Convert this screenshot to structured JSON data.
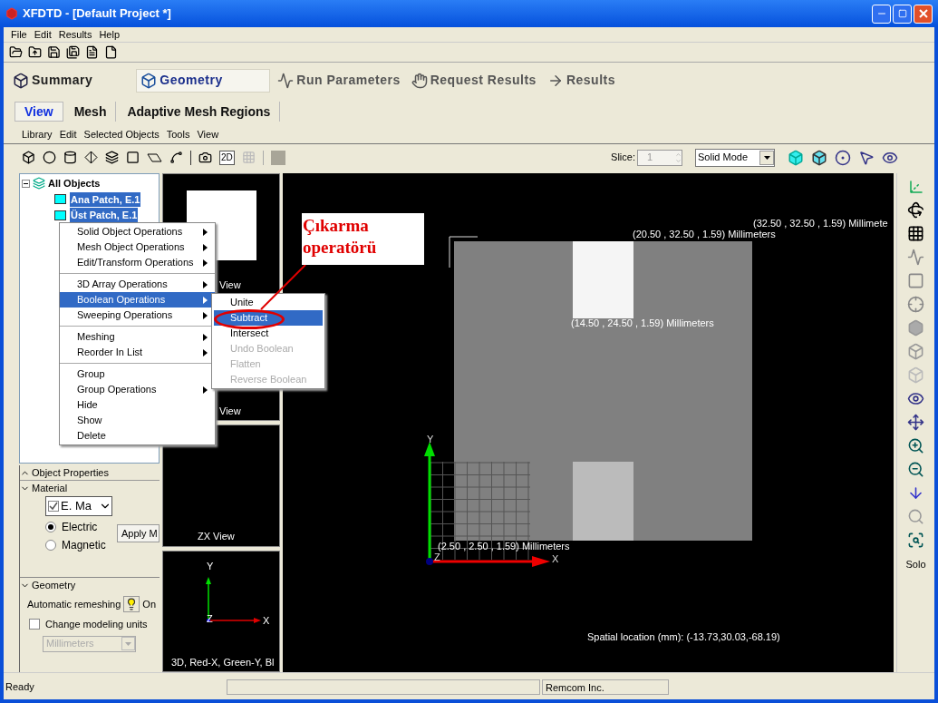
{
  "window": {
    "title": "XFDTD - [Default Project *]"
  },
  "menu": [
    "File",
    "Edit",
    "Results",
    "Help"
  ],
  "main_tabs": [
    {
      "label": "Summary",
      "selected": false
    },
    {
      "label": "Geometry",
      "selected": true
    },
    {
      "label": "Run Parameters",
      "selected": false
    },
    {
      "label": "Request Results",
      "selected": false
    },
    {
      "label": "Results",
      "selected": false
    }
  ],
  "sub_tabs": [
    {
      "label": "View",
      "selected": true
    },
    {
      "label": "Mesh",
      "selected": false
    },
    {
      "label": "Adaptive Mesh Regions",
      "selected": false
    }
  ],
  "geometry_menu": [
    "Library",
    "Edit",
    "Selected Objects",
    "Tools",
    "View"
  ],
  "tool_text_button": "2D",
  "slice": {
    "label": "Slice:",
    "value": "1"
  },
  "mode": {
    "value": "Solid Mode"
  },
  "tree": {
    "label": "All Objects",
    "expanded": true,
    "children": [
      {
        "label": "Ana Patch, E.1",
        "selected": true
      },
      {
        "label": "Üst Patch, E.1",
        "selected": true
      }
    ]
  },
  "context_menu": {
    "groups": [
      [
        {
          "label": "Solid Object Operations",
          "submenu": true,
          "selected": false
        },
        {
          "label": "Mesh Object Operations",
          "submenu": true,
          "selected": false
        },
        {
          "label": "Edit/Transform Operations",
          "submenu": true,
          "selected": false
        }
      ],
      [
        {
          "label": "3D Array Operations",
          "submenu": true,
          "selected": false
        },
        {
          "label": "Boolean Operations",
          "submenu": true,
          "selected": true
        },
        {
          "label": "Sweeping Operations",
          "submenu": true,
          "selected": false
        }
      ],
      [
        {
          "label": "Meshing",
          "submenu": true,
          "selected": false
        },
        {
          "label": "Reorder In List",
          "submenu": true,
          "selected": false
        }
      ],
      [
        {
          "label": "Group",
          "submenu": false,
          "selected": false
        },
        {
          "label": "Group Operations",
          "submenu": true,
          "selected": false
        },
        {
          "label": "Hide",
          "submenu": false,
          "selected": false
        },
        {
          "label": "Show",
          "submenu": false,
          "selected": false
        },
        {
          "label": "Delete",
          "submenu": false,
          "selected": false
        }
      ]
    ]
  },
  "submenu": {
    "items": [
      {
        "label": "Unite",
        "selected": false,
        "disabled": false
      },
      {
        "label": "Subtract",
        "selected": true,
        "disabled": false
      },
      {
        "label": "Intersect",
        "selected": false,
        "disabled": false
      },
      {
        "label": "Undo Boolean",
        "selected": false,
        "disabled": true
      },
      {
        "label": "Flatten",
        "selected": false,
        "disabled": true
      },
      {
        "label": "Reverse Boolean",
        "selected": false,
        "disabled": true
      }
    ]
  },
  "callout": {
    "lines": [
      "Çıkarma",
      "operatörü"
    ]
  },
  "small_views": [
    {
      "label": "View",
      "kind": "rect"
    },
    {
      "label": "View",
      "kind": "empty"
    },
    {
      "label": "ZX View",
      "kind": "empty"
    },
    {
      "label": "3D, Red-X, Green-Y, Bl",
      "kind": "axes",
      "axes": [
        "X",
        "Y",
        "Z"
      ]
    }
  ],
  "viewport": {
    "labels": [
      "(32.50 , 32.50 , 1.59) Millimete",
      "(20.50 , 32.50 , 1.59) Millimeters",
      "(14.50 , 24.50 , 1.59) Millimeters",
      "(2.50 , 2.50 , 1.59) Millimeters"
    ],
    "axes": [
      "X",
      "Y",
      "Z"
    ],
    "location": "Spatial location (mm): (-13.73,30.03,-68.19)"
  },
  "right_toolbar": {
    "text_button": "Solo"
  },
  "properties": {
    "header": "Object Properties",
    "material_header": "Material",
    "material": {
      "value": "E. Ma",
      "checked": true
    },
    "radios": [
      {
        "label": "Electric",
        "selected": true
      },
      {
        "label": "Magnetic",
        "selected": false
      }
    ],
    "apply_button": "Apply M",
    "geometry_header": "Geometry",
    "remesh": {
      "label": "Automatic remeshing",
      "state": "On"
    },
    "units": {
      "label": "Change modeling units",
      "checked": false
    },
    "units_select": {
      "value": "Millimeters",
      "disabled": true
    }
  },
  "status_bar": {
    "left": "Ready",
    "right": "Remcom Inc."
  }
}
